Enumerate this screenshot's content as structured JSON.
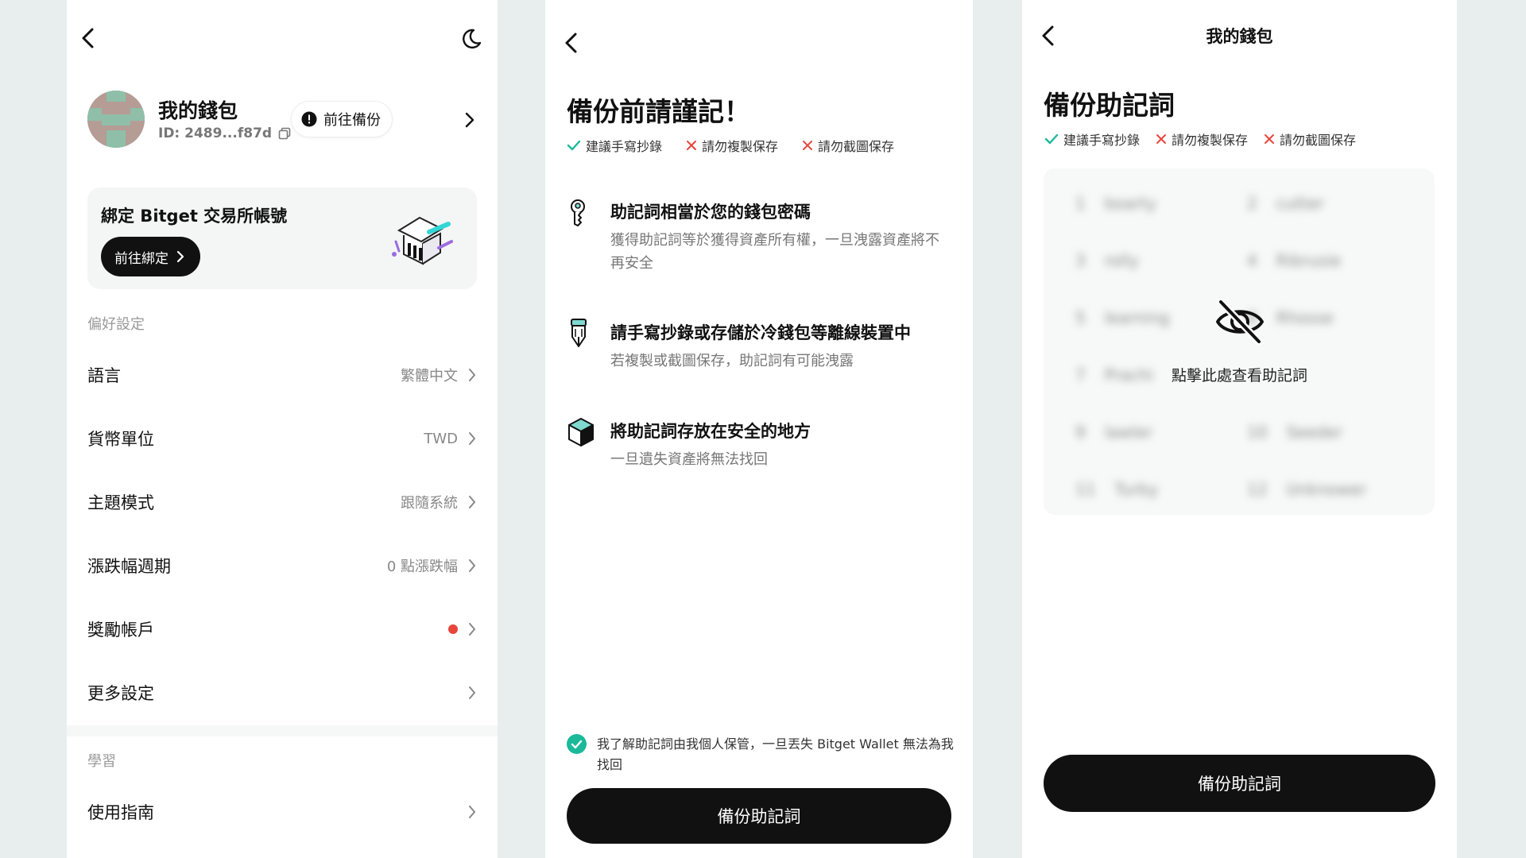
{
  "screen1": {
    "wallet": {
      "name": "我的錢包",
      "id": "ID: 2489...f87d",
      "backup_pill": "前往備份"
    },
    "bind_card": {
      "title": "綁定 Bitget 交易所帳號",
      "button": "前往綁定"
    },
    "preferences_label": "偏好設定",
    "rows": [
      {
        "label": "語言",
        "value": "繁體中文"
      },
      {
        "label": "貨幣單位",
        "value": "TWD"
      },
      {
        "label": "主題模式",
        "value": "跟隨系統"
      },
      {
        "label": "漲跌幅週期",
        "value": "0 點漲跌幅"
      },
      {
        "label": "獎勵帳戶",
        "value": ""
      },
      {
        "label": "更多設定",
        "value": ""
      }
    ],
    "learn_label": "學習",
    "guide_row": {
      "label": "使用指南"
    },
    "reward_dot_color": "#e8453c"
  },
  "screen2": {
    "title": "備份前請謹記！",
    "tags": {
      "ok": "建議手寫抄錄",
      "no_copy": "請勿複製保存",
      "no_screenshot": "請勿截圖保存"
    },
    "items": [
      {
        "icon": "key-icon",
        "title": "助記詞相當於您的錢包密碼",
        "desc": "獲得助記詞等於獲得資產所有權，一旦洩露資產將不再安全"
      },
      {
        "icon": "pen-icon",
        "title": "請手寫抄錄或存儲於冷錢包等離線裝置中",
        "desc": "若複製或截圖保存，助記詞有可能洩露"
      },
      {
        "icon": "box-icon",
        "title": "將助記詞存放在安全的地方",
        "desc": "一旦遺失資產將無法找回"
      }
    ],
    "agreement": "我了解助記詞由我個人保管，一旦丟失 Bitget Wallet 無法為我找回",
    "button": "備份助記詞",
    "accent_color": "#1bb99a"
  },
  "screen3": {
    "header": "我的錢包",
    "title": "備份助記詞",
    "tags": {
      "ok": "建議手寫抄錄",
      "no_copy": "請勿複製保存",
      "no_screenshot": "請勿截圖保存"
    },
    "reveal_text": "點擊此處查看助記詞",
    "button": "備份助記詞",
    "blurred_words": [
      "boarty",
      "cutter",
      "rolly",
      "Ribrusie",
      "learning",
      "Rhosse",
      "Prachi",
      "",
      "lawler",
      "Seeder",
      "Turby",
      "Unknower"
    ]
  }
}
